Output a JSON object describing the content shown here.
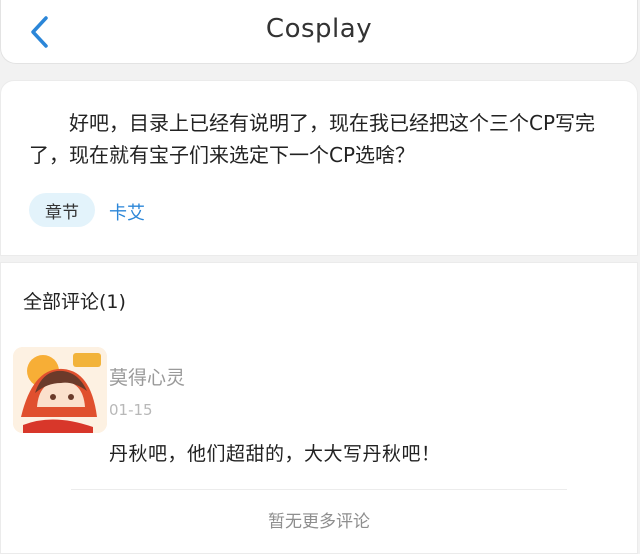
{
  "header": {
    "title": "Cosplay",
    "back_icon": "chevron-left-icon",
    "accent_color": "#2b86d8"
  },
  "post": {
    "body": "好吧，目录上已经有说明了，现在我已经把这个三个CP写完了，现在就有宝子们来选定下一个CP选啥？",
    "chapter_tag": "章节",
    "chapter_link": "卡艾"
  },
  "comments": {
    "title": "全部评论(1)",
    "items": [
      {
        "avatar_icon": "anime-avatar",
        "username": "莫得心灵",
        "date": "01-15",
        "text": "丹秋吧，他们超甜的，大大写丹秋吧！"
      }
    ],
    "no_more": "暂无更多评论"
  }
}
